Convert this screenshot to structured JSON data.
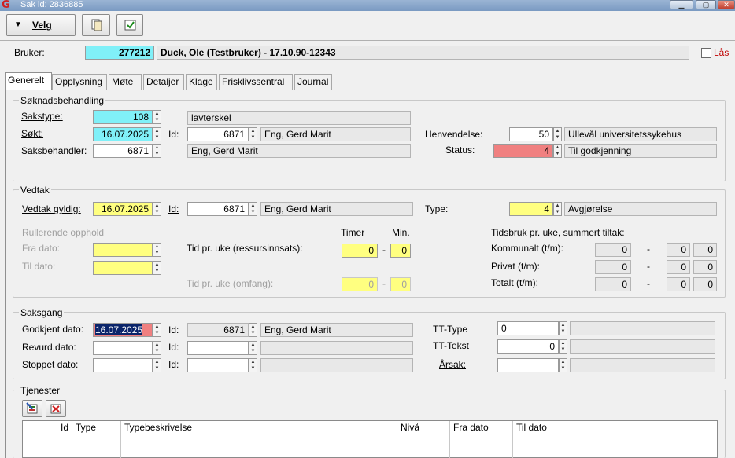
{
  "window": {
    "title": "Sak  id: 2836885",
    "logo": "G"
  },
  "toolbar": {
    "velg_label": "Velg"
  },
  "user": {
    "label": "Bruker:",
    "id": "277212",
    "name": "Duck, Ole (Testbruker) - 17.10.90-12343",
    "lock_label": "Lås"
  },
  "tabs": [
    "Generelt",
    "Opplysning",
    "Møte",
    "Detaljer",
    "Klage",
    "Frisklivssentral",
    "Journal"
  ],
  "soknad": {
    "title": "Søknadsbehandling",
    "sakstype_label": "Sakstype:",
    "sakstype_value": "108",
    "sakstype_text": "lavterskel",
    "sokt_label": "Søkt:",
    "sokt_value": "16.07.2025",
    "sokt_id_label": "Id:",
    "sokt_id": "6871",
    "sokt_name": "Eng, Gerd Marit",
    "henvendelse_label": "Henvendelse:",
    "henvendelse_value": "50",
    "henvendelse_text": "Ullevål universitetssykehus",
    "saksbehandler_label": "Saksbehandler:",
    "saksbehandler_value": "6871",
    "saksbehandler_name": "Eng, Gerd Marit",
    "status_label": "Status:",
    "status_value": "4",
    "status_text": "Til godkjenning"
  },
  "vedtak": {
    "title": "Vedtak",
    "gyldig_label": "Vedtak gyldig:",
    "gyldig_value": "16.07.2025",
    "id_label": "Id:",
    "id_value": "6871",
    "id_name": "Eng, Gerd Marit",
    "type_label": "Type:",
    "type_value": "4",
    "type_text": "Avgjørelse",
    "rullerende_label": "Rullerende opphold",
    "fra_label": "Fra dato:",
    "til_label": "Til dato:",
    "timer_label": "Timer",
    "min_label": "Min.",
    "ressurs_label": "Tid pr. uke (ressursinnsats):",
    "ressurs_timer": "0",
    "ressurs_min": "0",
    "omfang_label": "Tid pr. uke (omfang):",
    "omfang_timer": "0",
    "omfang_min": "0",
    "tidsbruk_label": "Tidsbruk pr. uke, summert tiltak:",
    "kommunalt_label": "Kommunalt (t/m):",
    "kommunalt_t": "0",
    "kommunalt_m1": "0",
    "kommunalt_m2": "0",
    "privat_label": "Privat (t/m):",
    "privat_t": "0",
    "privat_m1": "0",
    "privat_m2": "0",
    "totalt_label": "Totalt (t/m):",
    "totalt_t": "0",
    "totalt_m1": "0",
    "totalt_m2": "0",
    "dash": "-"
  },
  "saksgang": {
    "title": "Saksgang",
    "godkjent_label": "Godkjent dato:",
    "godkjent_value": "16.07.2025",
    "godkjent_id_label": "Id:",
    "godkjent_id": "6871",
    "godkjent_name": "Eng, Gerd Marit",
    "revurd_label": "Revurd.dato:",
    "revurd_id_label": "Id:",
    "stoppet_label": "Stoppet dato:",
    "stoppet_id_label": "Id:",
    "tt_type_label": "TT-Type",
    "tt_type_value": "0",
    "tt_tekst_label": "TT-Tekst",
    "tt_tekst_value": "0",
    "arsak_label": "Årsak:"
  },
  "tjenester": {
    "title": "Tjenester",
    "columns": [
      "Id",
      "Type",
      "Typebeskrivelse",
      "Nivå",
      "Fra dato",
      "Til dato"
    ]
  },
  "colors": {
    "cyan": "#80f0f8",
    "yellow": "#ffff80",
    "red": "#f08080",
    "selection": "#0a246a"
  }
}
